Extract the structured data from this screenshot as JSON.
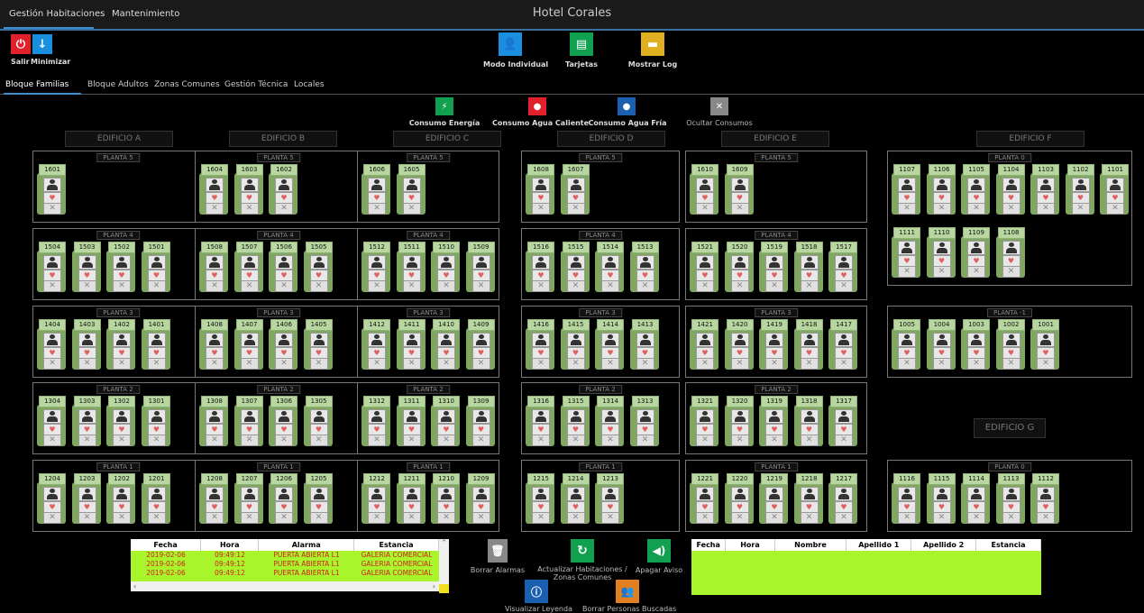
{
  "top_tabs": [
    "Gestión Habitaciones",
    "Mantenimiento"
  ],
  "app_title": "Hotel Corales",
  "window_buttons": {
    "exit": "Salir",
    "minimize": "Minimizar"
  },
  "mode_buttons": {
    "individual": "Modo Individual",
    "cards": "Tarjetas",
    "log": "Mostrar Log"
  },
  "sub_tabs": [
    "Bloque Familias",
    "Bloque Adultos",
    "Zonas Comunes",
    "Gestión Técnica",
    "Locales"
  ],
  "consumption_buttons": {
    "energy": "Consumo Energía",
    "hot_water": "Consumo Agua Caliente",
    "cold_water": "Consumo Agua Fría",
    "hide": "Ocultar Consumos"
  },
  "buildings": [
    {
      "name": "EDIFICIO A",
      "floors": [
        {
          "name": "PLANTA 5",
          "rooms": [
            "1601"
          ]
        },
        {
          "name": "PLANTA 4",
          "rooms": [
            "1504",
            "1503",
            "1502",
            "1501"
          ]
        },
        {
          "name": "PLANTA 3",
          "rooms": [
            "1404",
            "1403",
            "1402",
            "1401"
          ]
        },
        {
          "name": "PLANTA 2",
          "rooms": [
            "1304",
            "1303",
            "1302",
            "1301"
          ]
        },
        {
          "name": "PLANTA 1",
          "rooms": [
            "1204",
            "1203",
            "1202",
            "1201"
          ]
        }
      ]
    },
    {
      "name": "EDIFICIO B",
      "floors": [
        {
          "name": "PLANTA 5",
          "rooms": [
            "1604",
            "1603",
            "1602"
          ]
        },
        {
          "name": "PLANTA 4",
          "rooms": [
            "1508",
            "1507",
            "1506",
            "1505"
          ]
        },
        {
          "name": "PLANTA 3",
          "rooms": [
            "1408",
            "1407",
            "1406",
            "1405"
          ]
        },
        {
          "name": "PLANTA 2",
          "rooms": [
            "1308",
            "1307",
            "1306",
            "1305"
          ]
        },
        {
          "name": "PLANTA 1",
          "rooms": [
            "1208",
            "1207",
            "1206",
            "1205"
          ]
        }
      ]
    },
    {
      "name": "EDIFICIO C",
      "floors": [
        {
          "name": "PLANTA 5",
          "rooms": [
            "1606",
            "1605"
          ]
        },
        {
          "name": "PLANTA 4",
          "rooms": [
            "1512",
            "1511",
            "1510",
            "1509"
          ]
        },
        {
          "name": "PLANTA 3",
          "rooms": [
            "1412",
            "1411",
            "1410",
            "1409"
          ]
        },
        {
          "name": "PLANTA 2",
          "rooms": [
            "1312",
            "1311",
            "1310",
            "1309"
          ]
        },
        {
          "name": "PLANTA 1",
          "rooms": [
            "1212",
            "1211",
            "1210",
            "1209"
          ]
        }
      ]
    },
    {
      "name": "EDIFICIO D",
      "floors": [
        {
          "name": "PLANTA 5",
          "rooms": [
            "1608",
            "1607"
          ]
        },
        {
          "name": "PLANTA 4",
          "rooms": [
            "1516",
            "1515",
            "1514",
            "1513"
          ]
        },
        {
          "name": "PLANTA 3",
          "rooms": [
            "1416",
            "1415",
            "1414",
            "1413"
          ]
        },
        {
          "name": "PLANTA 2",
          "rooms": [
            "1316",
            "1315",
            "1314",
            "1313"
          ]
        },
        {
          "name": "PLANTA 1",
          "rooms": [
            "1215",
            "1214",
            "1213"
          ]
        }
      ]
    },
    {
      "name": "EDIFICIO E",
      "floors": [
        {
          "name": "PLANTA 5",
          "rooms": [
            "1610",
            "1609"
          ]
        },
        {
          "name": "PLANTA 4",
          "rooms": [
            "1521",
            "1520",
            "1519",
            "1518",
            "1517"
          ]
        },
        {
          "name": "PLANTA 3",
          "rooms": [
            "1421",
            "1420",
            "1419",
            "1418",
            "1417"
          ]
        },
        {
          "name": "PLANTA 2",
          "rooms": [
            "1321",
            "1320",
            "1319",
            "1318",
            "1317"
          ]
        },
        {
          "name": "PLANTA 1",
          "rooms": [
            "1221",
            "1220",
            "1219",
            "1218",
            "1217"
          ]
        }
      ]
    },
    {
      "name": "EDIFICIO F",
      "floors": [
        {
          "name": "PLANTA 0",
          "rooms": [
            "1107",
            "1106",
            "1105",
            "1104",
            "1103",
            "1102",
            "1101",
            "1111",
            "1110",
            "1109",
            "1108"
          ]
        },
        {
          "name": "PLANTA -1",
          "rooms": [
            "1005",
            "1004",
            "1003",
            "1002",
            "1001"
          ]
        }
      ]
    },
    {
      "name": "EDIFICIO G",
      "floors": [
        {
          "name": "PLANTA 0",
          "rooms": [
            "1116",
            "1115",
            "1114",
            "1113",
            "1112"
          ]
        }
      ]
    }
  ],
  "alarms_table": {
    "columns": [
      "Fecha",
      "Hora",
      "Alarma",
      "Estancia"
    ],
    "rows": [
      [
        "2019-02-06",
        "09:49:12",
        "PUERTA ABIERTA L1",
        "GALERIA COMERCIAL"
      ],
      [
        "2019-02-06",
        "09:49:12",
        "PUERTA ABIERTA L1",
        "GALERIA COMERCIAL"
      ],
      [
        "2019-02-06",
        "09:49:12",
        "PUERTA ABIERTA L1",
        "GALERIA COMERCIAL"
      ]
    ]
  },
  "action_buttons": {
    "clear_alarms": "Borrar Alarmas",
    "refresh": "Actualizar Habitaciones / Zonas Comunes",
    "mute": "Apagar Aviso",
    "legend": "Visualizar Leyenda",
    "clear_search": "Borrar Personas Buscadas"
  },
  "persons_table": {
    "columns": [
      "Fecha",
      "Hora",
      "Nombre",
      "Apellido 1",
      "Apellido 2",
      "Estancia"
    ]
  },
  "colors": {
    "room": "#7fa760",
    "table_row": "#a9f52b",
    "alarm_text": "#d02020",
    "exit": "#e0202a",
    "minimize": "#1a8fe0",
    "individual": "#1a8fe0",
    "cards": "#10a050",
    "log": "#e0b020",
    "energy": "#10a050",
    "hot_water": "#e0202a",
    "cold_water": "#1a5fb0",
    "hide": "#888888",
    "tab_active": "#3a8fd0"
  }
}
